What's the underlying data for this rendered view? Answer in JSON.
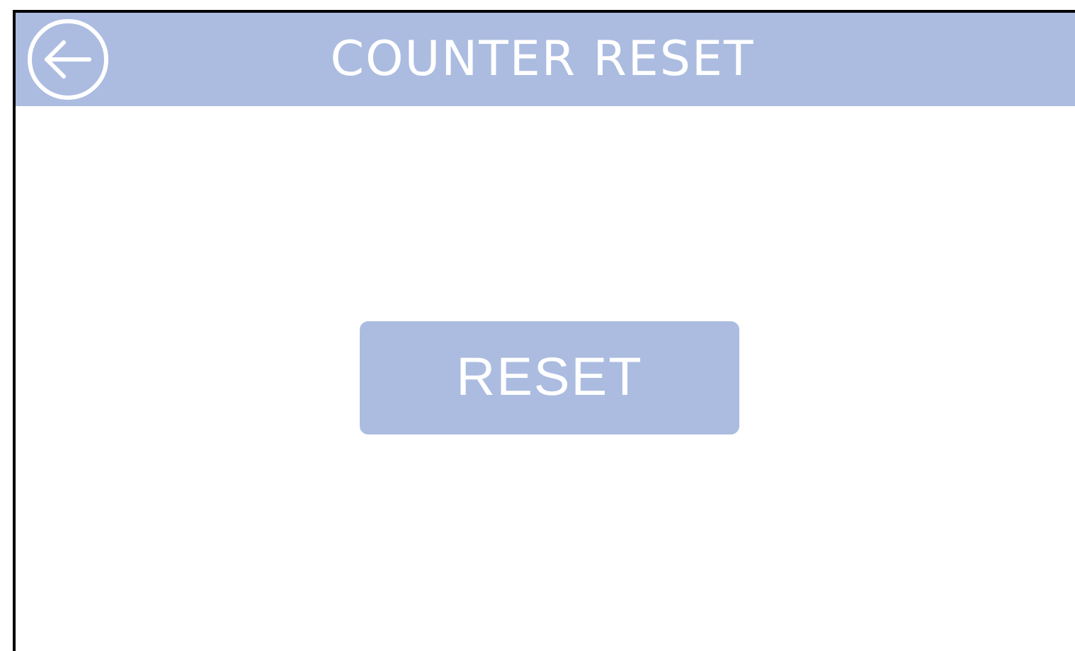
{
  "header": {
    "title": "COUNTER RESET"
  },
  "button": {
    "label": "RESET"
  }
}
